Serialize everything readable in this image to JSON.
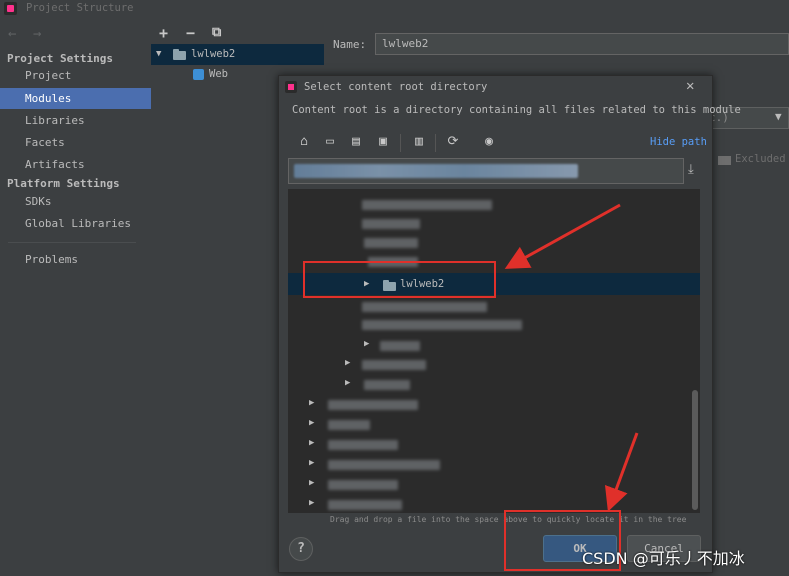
{
  "window": {
    "title": "Project Structure"
  },
  "sidebar": {
    "nav_back": "←",
    "nav_forward": "→",
    "project_settings_header": "Project Settings",
    "project_items": [
      {
        "label": "Project"
      },
      {
        "label": "Modules",
        "selected": true
      },
      {
        "label": "Libraries"
      },
      {
        "label": "Facets"
      },
      {
        "label": "Artifacts"
      }
    ],
    "platform_settings_header": "Platform Settings",
    "platform_items": [
      {
        "label": "SDKs"
      },
      {
        "label": "Global Libraries"
      }
    ],
    "problems_label": "Problems"
  },
  "module_tree": {
    "toolbar": {
      "add": "+",
      "remove": "−",
      "copy": "⧉"
    },
    "module_name": "lwlweb2",
    "facet_name": "Web"
  },
  "module_details": {
    "name_label": "Name:",
    "name_value": "lwlweb2",
    "combo_partial": "c.)",
    "excluded_label": "Excluded"
  },
  "dialog": {
    "title": "Select content root directory",
    "description": "Content root is a directory containing all files related to this module",
    "hide_path_link": "Hide path",
    "selected_folder": "lwlweb2",
    "drag_hint": "Drag and drop a file into the space above to quickly locate it in the tree",
    "ok_label": "OK",
    "cancel_label": "Cancel",
    "help_label": "?"
  },
  "watermark": "CSDN @可乐丿不加冰",
  "colors": {
    "background": "#3c3f41",
    "selection": "#4b6eaf",
    "tree_selection": "#0d293e",
    "link": "#589df6",
    "annotation_red": "#e0302a"
  }
}
